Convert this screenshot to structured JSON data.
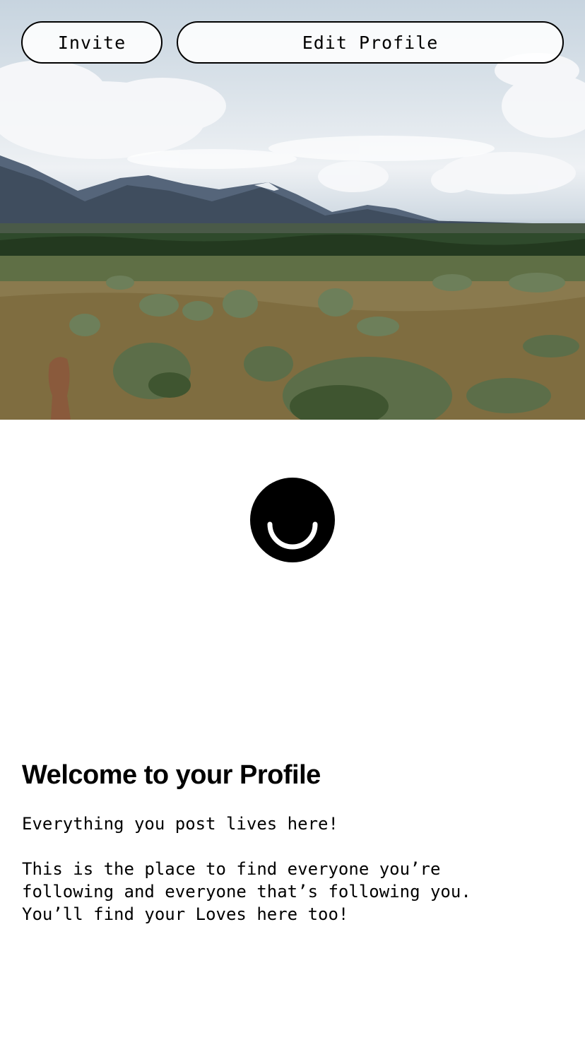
{
  "cover": {
    "image_description_icon": "landscape-cover-image"
  },
  "header": {
    "invite_label": "Invite",
    "edit_profile_label": "Edit Profile"
  },
  "avatar": {
    "icon": "smiley-avatar-icon",
    "color": "#000000"
  },
  "welcome": {
    "title": "Welcome to your Profile",
    "line1": "Everything you post lives here!",
    "paragraph2": "This is the place to find everyone you’re\nfollowing and everyone that’s following you.\nYou’ll find your Loves here too!"
  }
}
